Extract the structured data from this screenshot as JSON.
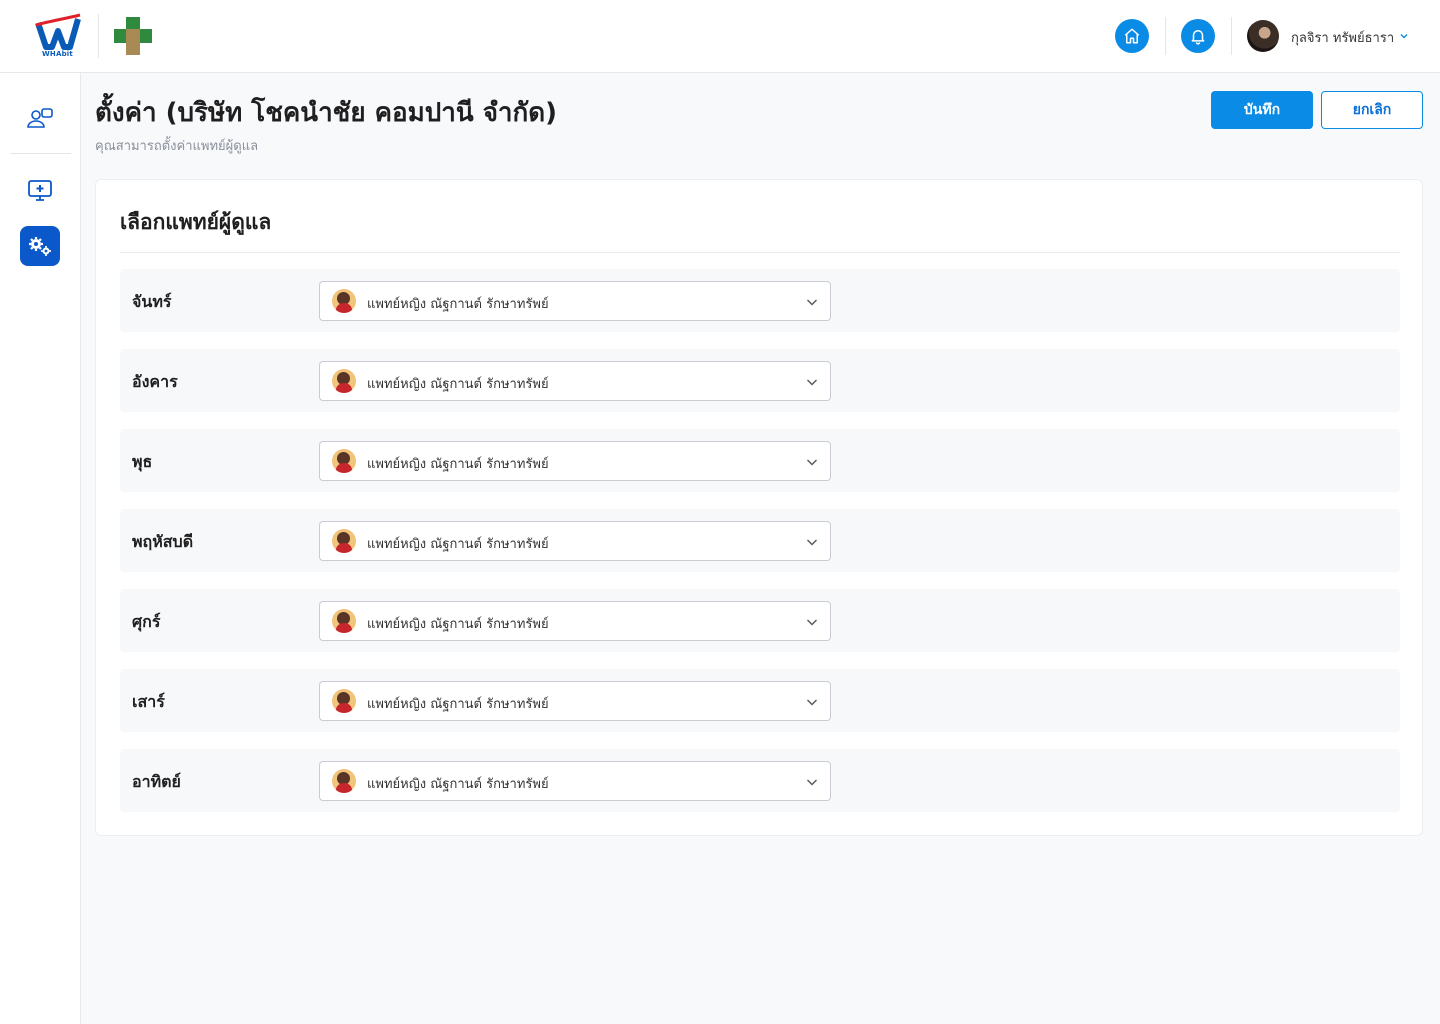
{
  "header": {
    "brand_logo_text": "WHAbit",
    "user_name": "กุลจิรา ทรัพย์ธารา",
    "accent_color": "#0a8be6"
  },
  "sidebar": {
    "items": [
      {
        "icon": "doctors-icon",
        "active": false
      },
      {
        "icon": "monitor-plus-icon",
        "active": false
      },
      {
        "icon": "settings-gears-icon",
        "active": true
      }
    ]
  },
  "page": {
    "title": "ตั้งค่า (บริษัท โชคนำชัย คอมปานี จำกัด)",
    "subtitle": "คุณสามารถตั้งค่าแพทย์ผู้ดูแล",
    "save_label": "บันทึก",
    "cancel_label": "ยกเลิก"
  },
  "card": {
    "title": "เลือกแพทย์ผู้ดูแล",
    "rows": [
      {
        "day": "จันทร์",
        "doctor": "แพทย์หญิง ณัฐกานต์ รักษาทรัพย์"
      },
      {
        "day": "อังคาร",
        "doctor": "แพทย์หญิง ณัฐกานต์ รักษาทรัพย์"
      },
      {
        "day": "พุธ",
        "doctor": "แพทย์หญิง ณัฐกานต์ รักษาทรัพย์"
      },
      {
        "day": "พฤหัสบดี",
        "doctor": "แพทย์หญิง ณัฐกานต์ รักษาทรัพย์"
      },
      {
        "day": "ศุกร์",
        "doctor": "แพทย์หญิง ณัฐกานต์ รักษาทรัพย์"
      },
      {
        "day": "เสาร์",
        "doctor": "แพทย์หญิง ณัฐกานต์ รักษาทรัพย์"
      },
      {
        "day": "อาทิตย์",
        "doctor": "แพทย์หญิง ณัฐกานต์ รักษาทรัพย์"
      }
    ]
  }
}
